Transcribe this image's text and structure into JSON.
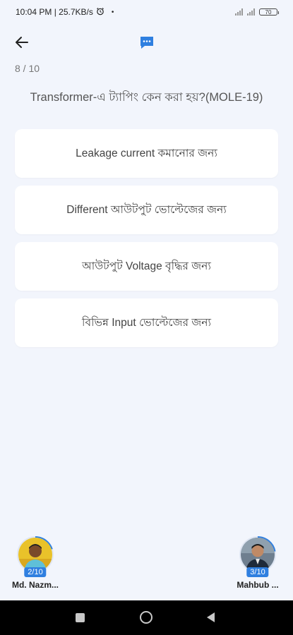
{
  "status_bar": {
    "time_speed": "10:04 PM | 25.7KB/s",
    "battery": "70"
  },
  "header": {
    "back_icon": "arrow-left-icon",
    "chat_icon": "chat-bubble-icon",
    "accent_color": "#2f7fe0"
  },
  "quiz": {
    "progress": "8 / 10",
    "question": "Transformer-এ ট্যাপিং কেন করা হয়?(MOLE-19)",
    "options": [
      "Leakage current কমানোর জন্য",
      "Different আউটপুট ভোল্টেজের জন্য",
      "আউটপুট Voltage বৃদ্ধির জন্য",
      "বিভিন্ন Input ভোল্টেজের জন্য"
    ]
  },
  "players": {
    "left": {
      "name": "Md. Nazm...",
      "score": "2/10"
    },
    "right": {
      "name": "Mahbub ...",
      "score": "3/10"
    }
  }
}
